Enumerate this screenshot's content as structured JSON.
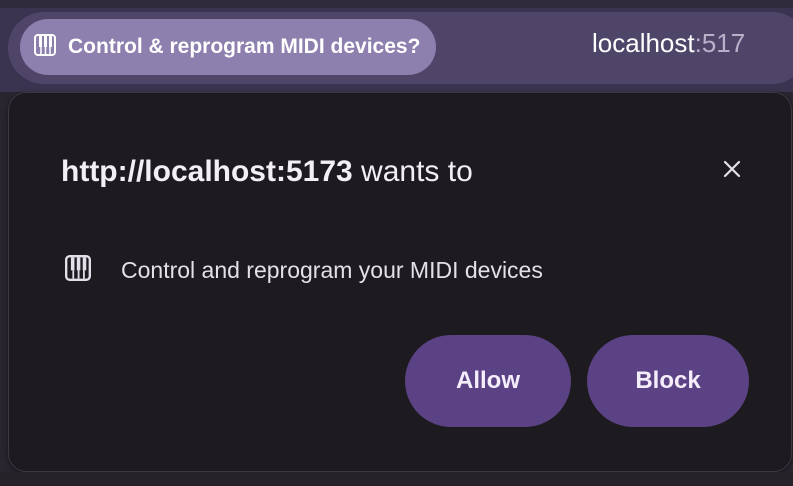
{
  "omnibox": {
    "chip_icon": "piano-icon",
    "chip_label": "Control & reprogram MIDI devices?",
    "url_host": "localhost",
    "url_port": ":517"
  },
  "dialog": {
    "origin": "http://localhost:5173",
    "title_suffix": " wants to",
    "close_icon": "close-icon",
    "permission_icon": "piano-icon",
    "permission_text": "Control and reprogram your MIDI devices",
    "allow_label": "Allow",
    "block_label": "Block"
  },
  "colors": {
    "accent": "#5b4284",
    "chip": "#8d7fae",
    "dialog_bg": "#1d1a20"
  }
}
